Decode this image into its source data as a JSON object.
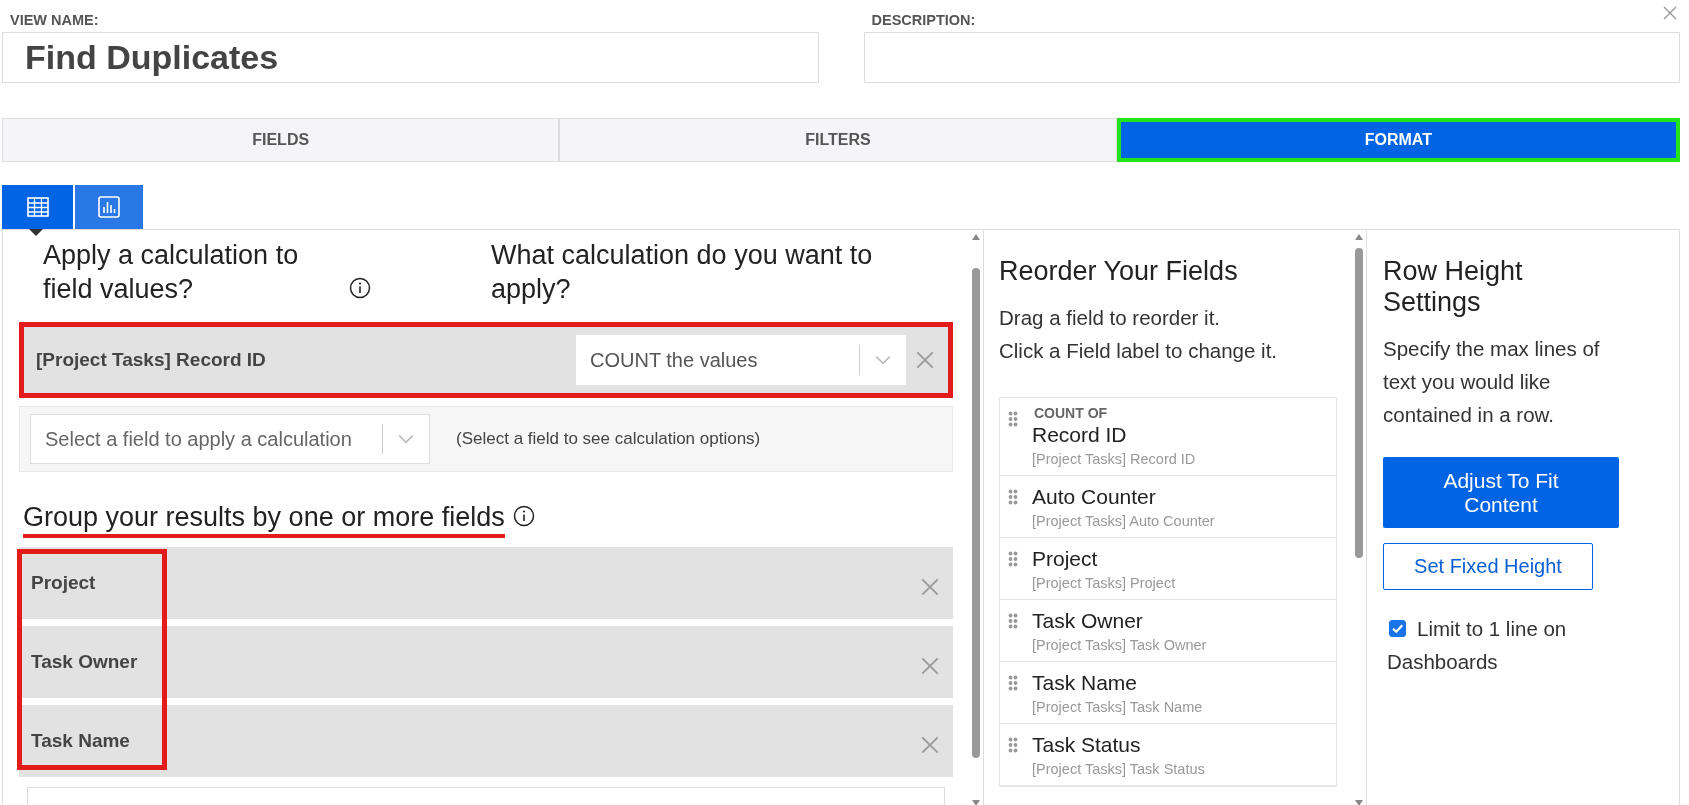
{
  "view_name": {
    "label": "VIEW NAME:",
    "value": "Find Duplicates"
  },
  "description": {
    "label": "DESCRIPTION:"
  },
  "tabs": [
    {
      "label": "FIELDS",
      "selected": false,
      "highlighted": false
    },
    {
      "label": "FILTERS",
      "selected": false,
      "highlighted": false
    },
    {
      "label": "FORMAT",
      "selected": true,
      "highlighted": true
    }
  ],
  "view_types": [
    {
      "kind": "table",
      "selected": true
    },
    {
      "kind": "chart",
      "selected": false
    }
  ],
  "calculations": {
    "heading": "Apply a calculation to field values?",
    "question": "What calculation do you want to apply?",
    "rows": [
      {
        "field": "[Project Tasks] Record ID",
        "calculation": "COUNT the values",
        "highlighted": true
      }
    ],
    "new_row": {
      "placeholder": "Select a field to apply a calculation",
      "hint": "(Select a field to see calculation options)"
    }
  },
  "group_by": {
    "heading": "Group your results by one or more fields",
    "underlined": true,
    "highlighted": true,
    "fields": [
      "Project",
      "Task Owner",
      "Task Name"
    ]
  },
  "reorder": {
    "heading": "Reorder Your Fields",
    "instructions": [
      "Drag a field to reorder it.",
      "Click a Field label to change it."
    ],
    "fields": [
      {
        "prefix": "COUNT OF",
        "label": "Record ID",
        "source": "[Project Tasks] Record ID"
      },
      {
        "label": "Auto Counter",
        "source": "[Project Tasks] Auto Counter"
      },
      {
        "label": "Project",
        "source": "[Project Tasks] Project"
      },
      {
        "label": "Task Owner",
        "source": "[Project Tasks] Task Owner"
      },
      {
        "label": "Task Name",
        "source": "[Project Tasks] Task Name"
      },
      {
        "label": "Task Status",
        "source": "[Project Tasks] Task Status"
      }
    ]
  },
  "row_height": {
    "heading": "Row Height Settings",
    "text": "Specify the max lines of text you would like contained in a row.",
    "buttons": [
      {
        "label": "Adjust To Fit Content",
        "selected": true
      },
      {
        "label": "Set Fixed Height",
        "selected": false
      }
    ],
    "limit": {
      "label": "Limit to 1 line on Dashboards",
      "checked": true
    }
  }
}
